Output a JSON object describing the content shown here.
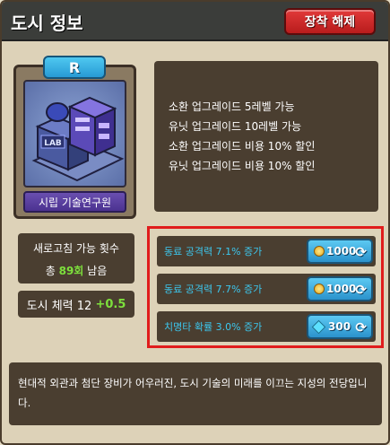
{
  "header": {
    "title": "도시 정보",
    "unequip_label": "장착 해제"
  },
  "card": {
    "rarity": "R",
    "name": "시립 기술연구원",
    "building_sign": "LAB"
  },
  "description": {
    "lines": [
      "소환 업그레이드 5레벨 가능",
      "유닛 업그레이드 10레벨 가능",
      "소환 업그레이드 비용 10% 할인",
      "유닛 업그레이드 비용 10% 할인"
    ]
  },
  "refresh": {
    "label": "새로고침 가능 횟수",
    "prefix": "총",
    "count": "89회",
    "suffix": "남음"
  },
  "city_hp": {
    "label": "도시 체력 12",
    "bonus": "+0.5"
  },
  "options": [
    {
      "label": "동료 공격력 7.1% 증가",
      "cost": "1000",
      "currency": "coin-icon"
    },
    {
      "label": "동료 공격력 7.7% 증가",
      "cost": "1000",
      "currency": "coin-icon"
    },
    {
      "label": "치명타 확률 3.0% 증가",
      "cost": "300",
      "currency": "gem-icon"
    }
  ],
  "lore": "현대적 외관과 첨단 장비가 어우러진, 도시 기술의 미래를 이끄는 지성의 전당입니다.",
  "colors": {
    "header_bg": "#3b3d3a",
    "unequip_red": "#e23a3a",
    "highlight_frame": "#e01c1c",
    "option_text": "#3cc7ee",
    "bonus_green": "#7de03c",
    "dark_box": "#4a3e30",
    "panel_bg": "#ddd2b8"
  }
}
